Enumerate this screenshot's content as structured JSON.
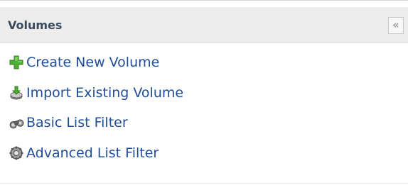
{
  "panel": {
    "title": "Volumes",
    "collapse_glyph": "«",
    "items": [
      {
        "label": "Create New Volume",
        "icon": "add-plus-icon"
      },
      {
        "label": "Import Existing Volume",
        "icon": "import-icon"
      },
      {
        "label": "Basic List Filter",
        "icon": "binoculars-icon"
      },
      {
        "label": "Advanced List Filter",
        "icon": "advanced-filter-gear-icon"
      }
    ]
  },
  "colors": {
    "header_bg": "#ececec",
    "title": "#3a4a5e",
    "link": "#1f4d99",
    "add_icon": "#48a930"
  }
}
